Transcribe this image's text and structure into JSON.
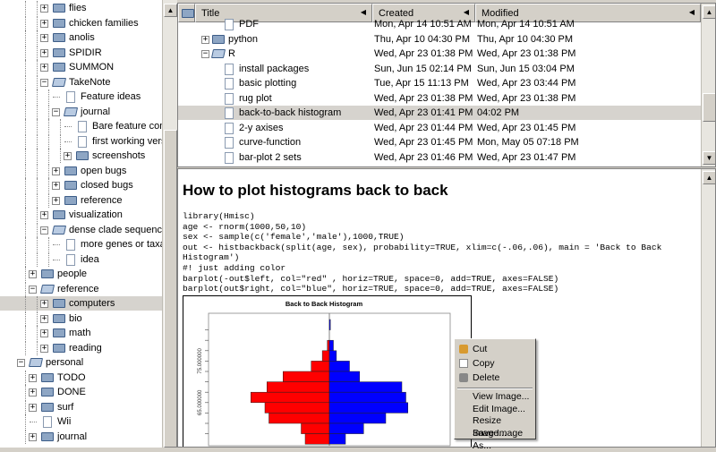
{
  "tree": {
    "items": [
      {
        "label": "flies",
        "level": 3,
        "type": "folder",
        "state": "collapsed"
      },
      {
        "label": "chicken families",
        "level": 3,
        "type": "folder",
        "state": "collapsed"
      },
      {
        "label": "anolis",
        "level": 3,
        "type": "folder",
        "state": "collapsed"
      },
      {
        "label": "SPIDIR",
        "level": 3,
        "type": "folder",
        "state": "collapsed"
      },
      {
        "label": "SUMMON",
        "level": 3,
        "type": "folder",
        "state": "collapsed"
      },
      {
        "label": "TakeNote",
        "level": 3,
        "type": "folder",
        "state": "expanded"
      },
      {
        "label": "Feature ideas",
        "level": 4,
        "type": "page"
      },
      {
        "label": "journal",
        "level": 4,
        "type": "folder",
        "state": "expanded"
      },
      {
        "label": "Bare feature complete",
        "level": 5,
        "type": "page"
      },
      {
        "label": "first working version of",
        "level": 5,
        "type": "page"
      },
      {
        "label": "screenshots",
        "level": 5,
        "type": "folder",
        "state": "collapsed"
      },
      {
        "label": "open bugs",
        "level": 4,
        "type": "folder",
        "state": "collapsed"
      },
      {
        "label": "closed bugs",
        "level": 4,
        "type": "folder",
        "state": "collapsed"
      },
      {
        "label": "reference",
        "level": 4,
        "type": "folder",
        "state": "collapsed"
      },
      {
        "label": "visualization",
        "level": 3,
        "type": "folder",
        "state": "collapsed"
      },
      {
        "label": "dense clade sequencing",
        "level": 3,
        "type": "folder",
        "state": "expanded"
      },
      {
        "label": "more genes or taxa",
        "level": 4,
        "type": "page"
      },
      {
        "label": "idea",
        "level": 4,
        "type": "page"
      },
      {
        "label": "people",
        "level": 2,
        "type": "folder",
        "state": "collapsed"
      },
      {
        "label": "reference",
        "level": 2,
        "type": "folder",
        "state": "expanded"
      },
      {
        "label": "computers",
        "level": 3,
        "type": "folder",
        "state": "collapsed",
        "selected": true
      },
      {
        "label": "bio",
        "level": 3,
        "type": "folder",
        "state": "collapsed"
      },
      {
        "label": "math",
        "level": 3,
        "type": "folder",
        "state": "collapsed"
      },
      {
        "label": "reading",
        "level": 3,
        "type": "folder",
        "state": "collapsed"
      },
      {
        "label": "personal",
        "level": 1,
        "type": "folder",
        "state": "expanded"
      },
      {
        "label": "TODO",
        "level": 2,
        "type": "folder",
        "state": "collapsed"
      },
      {
        "label": "DONE",
        "level": 2,
        "type": "folder",
        "state": "collapsed"
      },
      {
        "label": "surf",
        "level": 2,
        "type": "folder",
        "state": "collapsed"
      },
      {
        "label": "Wii",
        "level": 2,
        "type": "page"
      },
      {
        "label": "journal",
        "level": 2,
        "type": "folder",
        "state": "collapsed"
      }
    ]
  },
  "list": {
    "columns": [
      "Title",
      "Created",
      "Modified"
    ],
    "rows": [
      {
        "title": "PDF",
        "level": 1,
        "type": "page",
        "created": "Mon, Apr 14 10:51 AM",
        "modified": "Mon, Apr 14 10:51 AM"
      },
      {
        "title": "python",
        "level": 0,
        "type": "folder",
        "state": "collapsed",
        "created": "Thu, Apr 10 04:30 PM",
        "modified": "Thu, Apr 10 04:30 PM"
      },
      {
        "title": "R",
        "level": 0,
        "type": "folder",
        "state": "expanded",
        "created": "Wed, Apr 23 01:38 PM",
        "modified": "Wed, Apr 23 01:38 PM"
      },
      {
        "title": "install packages",
        "level": 1,
        "type": "page",
        "created": "Sun, Jun 15 02:14 PM",
        "modified": "Sun, Jun 15 03:04 PM"
      },
      {
        "title": "basic plotting",
        "level": 1,
        "type": "page",
        "created": "Tue, Apr 15 11:13 PM",
        "modified": "Wed, Apr 23 03:44 PM"
      },
      {
        "title": "rug plot",
        "level": 1,
        "type": "page",
        "created": "Wed, Apr 23 01:38 PM",
        "modified": "Wed, Apr 23 01:38 PM"
      },
      {
        "title": "back-to-back histogram",
        "level": 1,
        "type": "page",
        "created": "Wed, Apr 23 01:41 PM",
        "modified": "04:02 PM",
        "selected": true
      },
      {
        "title": "2-y axises",
        "level": 1,
        "type": "page",
        "created": "Wed, Apr 23 01:44 PM",
        "modified": "Wed, Apr 23 01:45 PM"
      },
      {
        "title": "curve-function",
        "level": 1,
        "type": "page",
        "created": "Wed, Apr 23 01:45 PM",
        "modified": "Mon, May 05 07:18 PM"
      },
      {
        "title": "bar-plot 2 sets",
        "level": 1,
        "type": "page",
        "created": "Wed, Apr 23 01:46 PM",
        "modified": "Wed, Apr 23 01:47 PM"
      }
    ]
  },
  "editor": {
    "title": "How to plot histograms back to back",
    "code": "library(Hmisc)\nage <- rnorm(1000,50,10)\nsex <- sample(c('female','male'),1000,TRUE)\nout <- histbackback(split(age, sex), probability=TRUE, xlim=c(-.06,.06), main = 'Back to Back\nHistogram')\n#! just adding color\nbarplot(-out$left, col=\"red\" , horiz=TRUE, space=0, add=TRUE, axes=FALSE)\nbarplot(out$right, col=\"blue\", horiz=TRUE, space=0, add=TRUE, axes=FALSE)"
  },
  "chart_data": {
    "type": "bar",
    "title": "Back to Back Histogram",
    "orientation": "horizontal-back-to-back",
    "ytick_labels": [
      "75.000000",
      "65.000000"
    ],
    "xlim": [
      -0.06,
      0.06
    ],
    "series": [
      {
        "name": "left",
        "color": "#ff0000",
        "values": [
          0,
          0,
          0.001,
          0.0035,
          0.009,
          0.023,
          0.031,
          0.039,
          0.032,
          0.03,
          0.014,
          0.012
        ]
      },
      {
        "name": "right",
        "color": "#0000ff",
        "values": [
          0.0005,
          0,
          0.002,
          0.0035,
          0.01,
          0.015,
          0.036,
          0.038,
          0.039,
          0.028,
          0.017,
          0.008
        ]
      }
    ]
  },
  "context_menu": {
    "items": [
      "Cut",
      "Copy",
      "Delete"
    ],
    "image_items": [
      "View Image...",
      "Edit Image...",
      "Resize Image...",
      "Save Image As..."
    ]
  }
}
